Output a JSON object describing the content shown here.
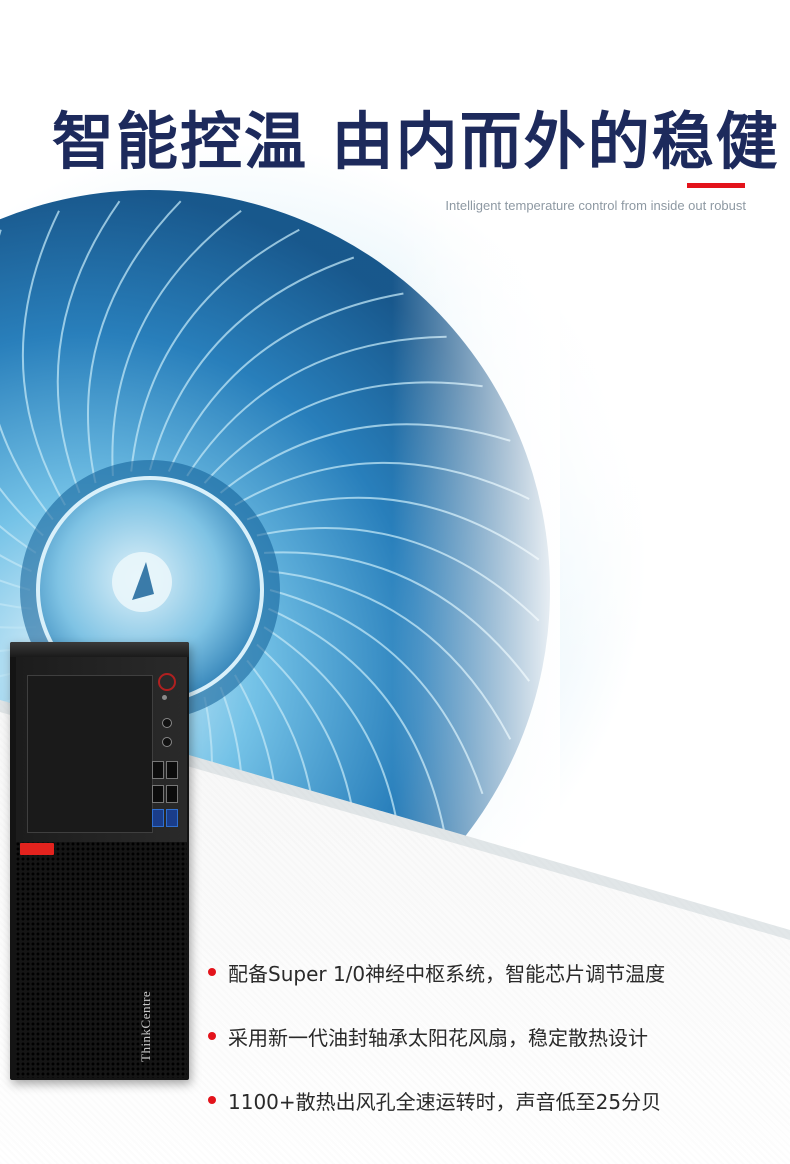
{
  "hero": {
    "title": "智能控温 由内而外的稳健",
    "subtitle": "Intelligent temperature control from inside out robust"
  },
  "product": {
    "brand_text": "ThinkCentre",
    "image_subject": "desktop-tower-pc"
  },
  "features": [
    {
      "text": "配备Super 1/0神经中枢系统，智能芯片调节温度"
    },
    {
      "text": "采用新一代油封轴承太阳花风扇，稳定散热设计"
    },
    {
      "text": "1100+散热出风孔全速运转时，声音低至25分贝"
    }
  ],
  "colors": {
    "title": "#1d2a5c",
    "accent_red": "#e3131b",
    "fan_blue": "#2a86c3"
  }
}
